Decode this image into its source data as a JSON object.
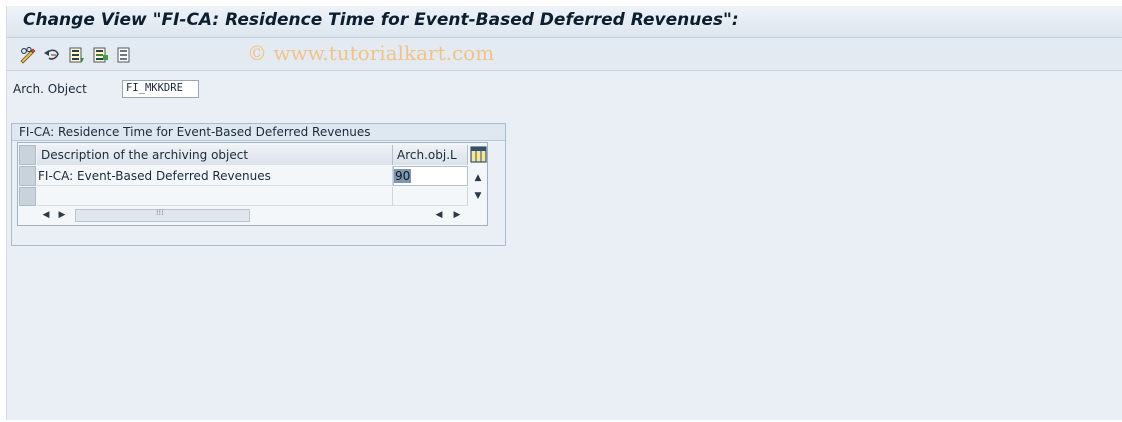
{
  "window": {
    "title": "Change View \"FI-CA: Residence Time for Event-Based Deferred Revenues\":"
  },
  "toolbar": {
    "buttons": [
      {
        "name": "display-change-icon"
      },
      {
        "name": "undo-icon"
      },
      {
        "name": "select-all-icon"
      },
      {
        "name": "select-block-icon"
      },
      {
        "name": "deselect-all-icon"
      }
    ],
    "watermark": "© www.tutorialkart.com"
  },
  "header_field": {
    "label": "Arch. Object",
    "value": "FI_MKKDRE"
  },
  "group": {
    "title": "FI-CA: Residence Time for Event-Based Deferred Revenues",
    "table": {
      "columns": [
        "Description of the archiving object",
        "Arch.obj.L"
      ],
      "rows": [
        {
          "description": "FI-CA: Event-Based Deferred Revenues",
          "residence": "90"
        },
        {
          "description": "",
          "residence": ""
        }
      ]
    }
  },
  "colors": {
    "title_text": "#0d1e2f",
    "background": "#e9eff5",
    "watermark": "#f2c28c",
    "selection": "#7f96ad"
  }
}
